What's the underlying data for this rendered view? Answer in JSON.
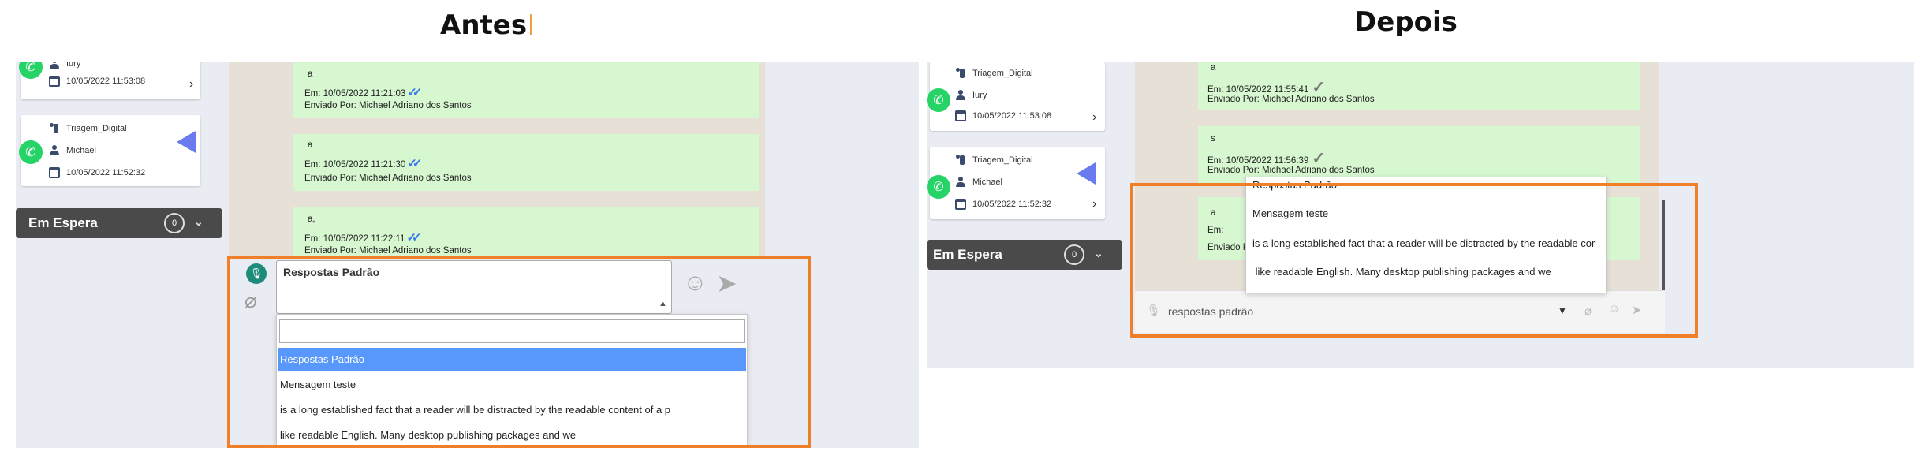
{
  "headings": {
    "before": "Antes",
    "after": "Depois"
  },
  "colors": {
    "highlight_box": "#f07f2a",
    "bubble": "#d6f7cf",
    "selected_option": "#5897fb",
    "whatsapp": "#25d366"
  },
  "before": {
    "contacts": [
      {
        "user": "Iury",
        "datetime": "10/05/2022 11:53:08"
      },
      {
        "team": "Triagem_Digital",
        "user": "Michael",
        "datetime": "10/05/2022 11:52:32"
      }
    ],
    "queue": {
      "label": "Em Espera",
      "count": "0"
    },
    "messages": [
      {
        "text": "a",
        "sent_at": "Em: 10/05/2022 11:21:03",
        "sent_by": "Enviado Por: Michael Adriano dos Santos"
      },
      {
        "text": "a",
        "sent_at": "Em: 10/05/2022 11:21:30",
        "sent_by": "Enviado Por: Michael Adriano dos Santos"
      },
      {
        "text": "a,",
        "sent_at": "Em: 10/05/2022 11:22:11",
        "sent_by": "Enviado Por: Michael Adriano dos Santos"
      }
    ],
    "composer": {
      "value": "Respostas Padrão",
      "search_value": ""
    },
    "options": [
      {
        "label": "Respostas Padrão",
        "selected": true
      },
      {
        "label": "Mensagem teste",
        "selected": false
      },
      {
        "label": "is a long established fact that a reader will be distracted by the readable content of a p",
        "selected": false
      },
      {
        "label": "like readable English. Many desktop publishing packages and we",
        "selected": false
      }
    ]
  },
  "after": {
    "contacts": [
      {
        "team": "Triagem_Digital",
        "user": "Iury",
        "datetime": "10/05/2022 11:53:08"
      },
      {
        "team": "Triagem_Digital",
        "user": "Michael",
        "datetime": "10/05/2022 11:52:32"
      }
    ],
    "queue": {
      "label": "Em Espera",
      "count": "0"
    },
    "messages": [
      {
        "text": "a",
        "sent_at": "Em: 10/05/2022 11:55:41",
        "sent_by": "Enviado Por: Michael Adriano dos Santos"
      },
      {
        "text": "s",
        "sent_at": "Em: 10/05/2022 11:56:39",
        "sent_by": "Enviado Por: Michael Adriano dos Santos"
      },
      {
        "text": "a",
        "sent_at": "Em:",
        "sent_by": "Enviado Po"
      }
    ],
    "composer": {
      "value": "respostas padrão"
    },
    "options": [
      {
        "label": "Respostas Padrão"
      },
      {
        "label": "Mensagem teste"
      },
      {
        "label": "is a long established fact that a reader will be distracted by the readable cor"
      },
      {
        "label": " like readable English. Many desktop publishing packages and we"
      }
    ]
  }
}
